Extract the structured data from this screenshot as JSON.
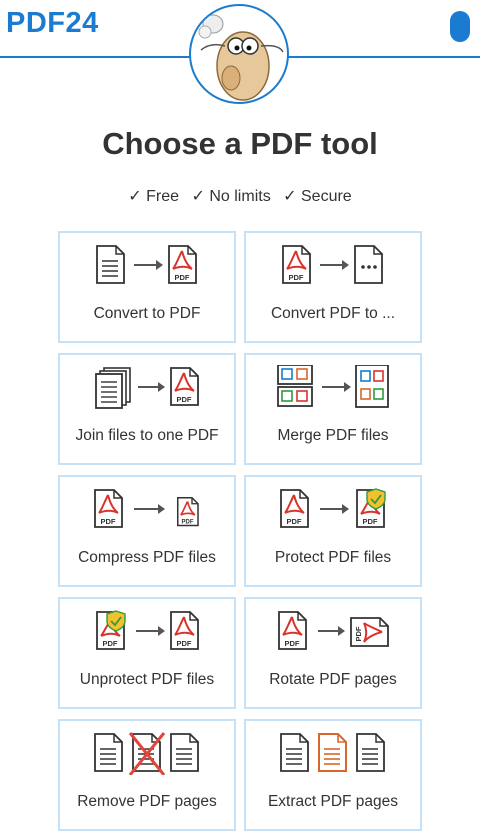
{
  "header": {
    "logo": "PDF24"
  },
  "title": "Choose a PDF tool",
  "features": [
    "✓ Free",
    "✓ No limits",
    "✓ Secure"
  ],
  "tools": [
    {
      "label": "Convert to PDF"
    },
    {
      "label": "Convert PDF to ..."
    },
    {
      "label": "Join files to one PDF"
    },
    {
      "label": "Merge PDF files"
    },
    {
      "label": "Compress PDF files"
    },
    {
      "label": "Protect PDF files"
    },
    {
      "label": "Unprotect PDF files"
    },
    {
      "label": "Rotate PDF pages"
    },
    {
      "label": "Remove PDF pages"
    },
    {
      "label": "Extract PDF pages"
    }
  ],
  "colors": {
    "brand": "#1a7bd0",
    "card_border": "#c6e1f5",
    "pdf_red": "#d9342b",
    "accent_orange": "#d9662b"
  }
}
